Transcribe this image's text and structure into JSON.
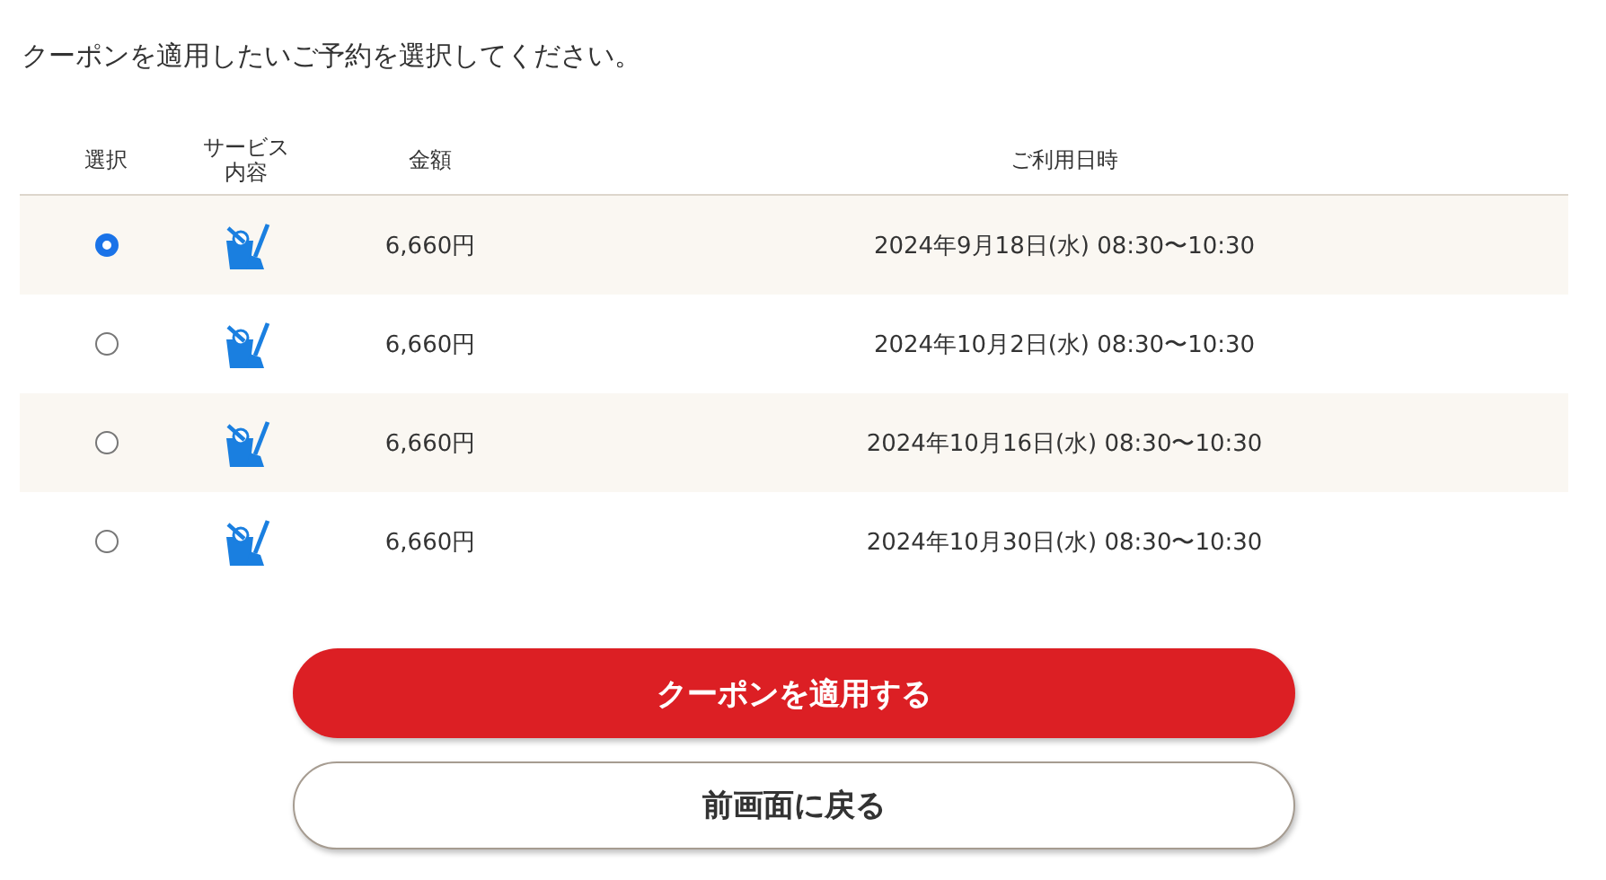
{
  "instruction": "クーポンを適用したいご予約を選択してください。",
  "table": {
    "columns": [
      "選択",
      "サービス内容",
      "金額",
      "ご利用日時"
    ],
    "rows": [
      {
        "selected": true,
        "price": "6,660円",
        "datetime": "2024年9月18日(水) 08:30〜10:30"
      },
      {
        "selected": false,
        "price": "6,660円",
        "datetime": "2024年10月2日(水) 08:30〜10:30"
      },
      {
        "selected": false,
        "price": "6,660円",
        "datetime": "2024年10月16日(水) 08:30〜10:30"
      },
      {
        "selected": false,
        "price": "6,660円",
        "datetime": "2024年10月30日(水) 08:30〜10:30"
      }
    ]
  },
  "buttons": {
    "primary": "クーポンを適用する",
    "secondary": "前画面に戻る"
  }
}
